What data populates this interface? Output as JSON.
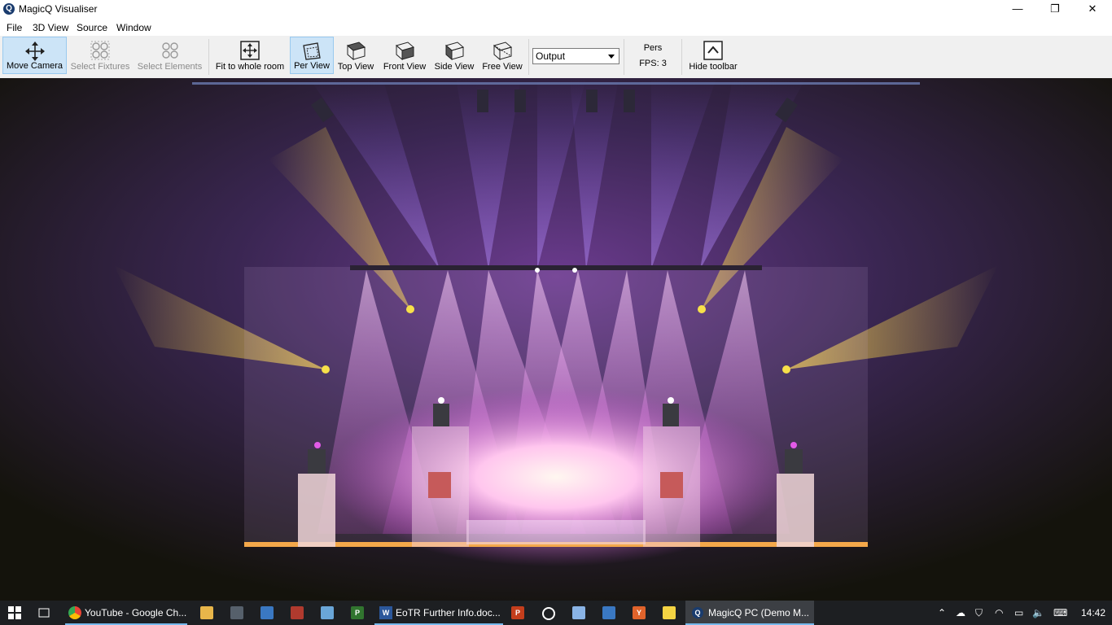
{
  "window": {
    "title": "MagicQ Visualiser",
    "minimize": "—",
    "maximize": "❐",
    "close": "✕"
  },
  "menu": [
    "File",
    "3D View",
    "Source",
    "Window"
  ],
  "toolbar": {
    "move_camera": "Move Camera",
    "select_fixtures": "Select Fixtures",
    "select_elements": "Select Elements",
    "fit_room": "Fit to whole room",
    "per_view": "Per View",
    "top_view": "Top View",
    "front_view": "Front View",
    "side_view": "Side View",
    "free_view": "Free View",
    "source_select": "Output",
    "projection": "Pers",
    "fps": "FPS: 3",
    "hide_toolbar": "Hide toolbar"
  },
  "taskbar": {
    "apps": [
      "YouTube - Google Ch...",
      "EoTR Further Info.doc...",
      "MagicQ PC (Demo M..."
    ],
    "clock": "14:42"
  },
  "colors": {
    "accent": "#cce4f7",
    "beam_yellow": "#f5d24a",
    "beam_magenta": "#e25ae8",
    "beam_violet": "#8a5cf0"
  }
}
